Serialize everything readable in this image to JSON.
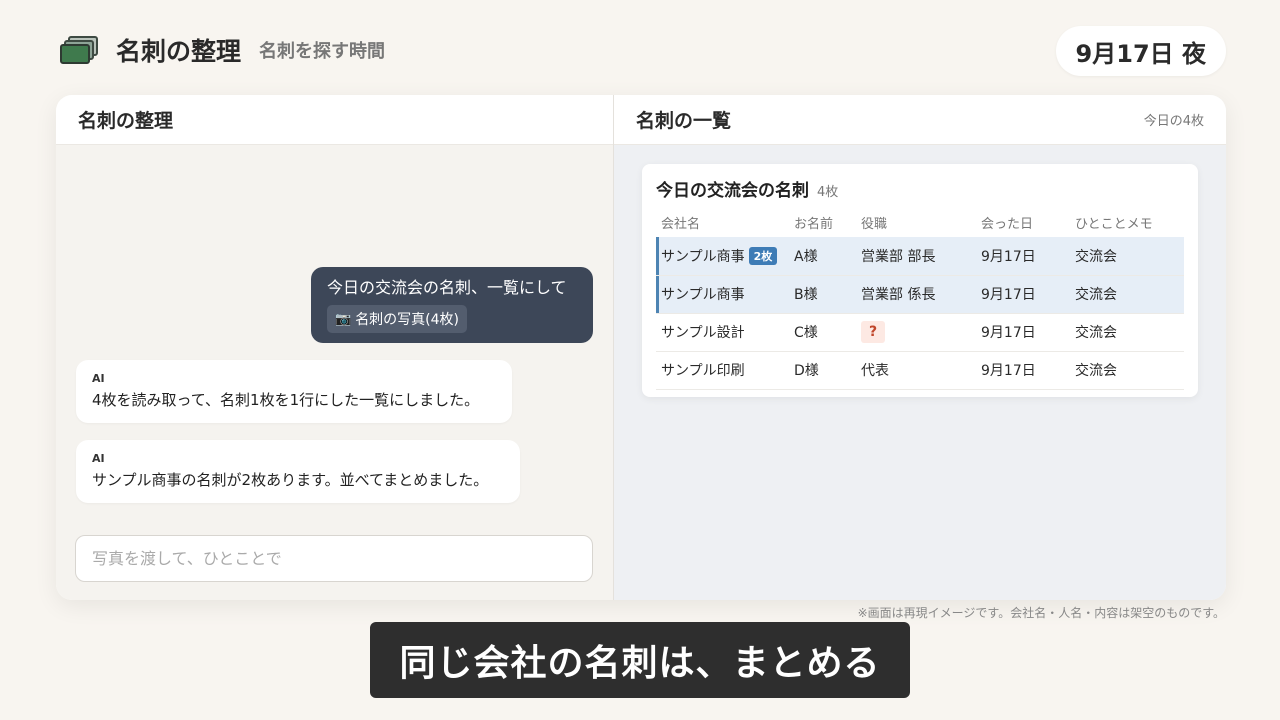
{
  "header": {
    "app_icon": "business-cards-icon",
    "title": "名刺の整理",
    "subtitle": "名刺を探す時間",
    "date": "9月17日 夜"
  },
  "left_pane": {
    "title": "名刺の整理",
    "user_message": "今日の交流会の名刺、一覧にして",
    "attachment": "名刺の写真(4枚)",
    "attachment_icon": "camera-icon",
    "ai_messages": [
      {
        "who": "AI",
        "text": "4枚を読み取って、名刺1枚を1行にした一覧にしました。"
      },
      {
        "who": "AI",
        "text": "サンプル商事の名刺が2枚あります。並べてまとめました。"
      }
    ],
    "input_placeholder": "写真を渡して、ひとことで"
  },
  "right_pane": {
    "title": "名刺の一覧",
    "count": "今日の4枚",
    "card": {
      "title": "今日の交流会の名刺",
      "count": "4枚",
      "columns": [
        "会社名",
        "お名前",
        "役職",
        "会った日",
        "ひとことメモ"
      ],
      "rows": [
        {
          "company": "サンプル商事",
          "badge": "2枚",
          "name": "A様",
          "role": "営業部 部長",
          "date": "9月17日",
          "memo": "交流会",
          "highlight": true
        },
        {
          "company": "サンプル商事",
          "badge": "",
          "name": "B様",
          "role": "営業部 係長",
          "date": "9月17日",
          "memo": "交流会",
          "highlight": true
        },
        {
          "company": "サンプル設計",
          "badge": "",
          "name": "C様",
          "role": "?",
          "date": "9月17日",
          "memo": "交流会",
          "highlight": false
        },
        {
          "company": "サンプル印刷",
          "badge": "",
          "name": "D様",
          "role": "代表",
          "date": "9月17日",
          "memo": "交流会",
          "highlight": false
        }
      ]
    }
  },
  "disclaimer": "※画面は再現イメージです。会社名・人名・内容は架空のものです。",
  "caption": "同じ会社の名刺は、まとめる",
  "colors": {
    "background": "#f8f5f0",
    "user_bubble": "#3d4758",
    "highlight_row": "#e6eef7",
    "accent_blue": "#3e7cb6",
    "caption_bg": "#2e2e2e"
  }
}
